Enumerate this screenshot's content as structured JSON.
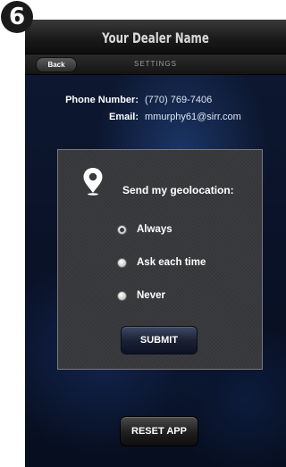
{
  "step_number": "6",
  "app": {
    "dealer_name": "Your Dealer Name"
  },
  "nav": {
    "back_label": "Back",
    "title": "SETTINGS"
  },
  "contact": {
    "phone_label": "Phone Number:",
    "phone_value": "(770) 769-7406",
    "email_label": "Email:",
    "email_value": "mmurphy61@sirr.com"
  },
  "geolocation": {
    "icon": "map-pin-icon",
    "title": "Send my geolocation:",
    "options": [
      {
        "label": "Always",
        "selected": true
      },
      {
        "label": "Ask each time",
        "selected": false
      },
      {
        "label": "Never",
        "selected": false
      }
    ],
    "submit_label": "SUBMIT"
  },
  "reset_label": "RESET APP"
}
